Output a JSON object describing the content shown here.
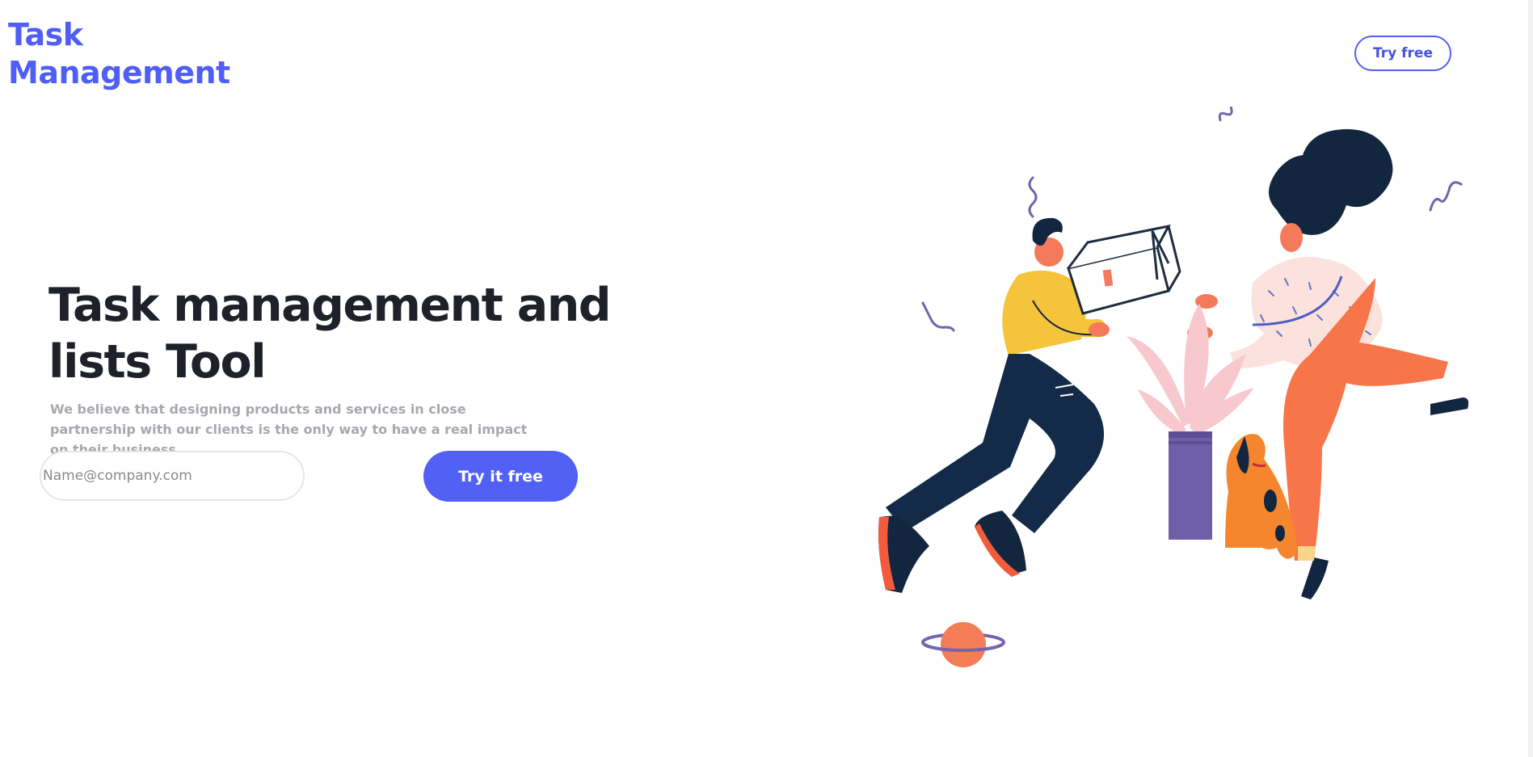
{
  "header": {
    "logo_line1": "Task",
    "logo_line2": "Management",
    "try_free_label": "Try free"
  },
  "hero": {
    "title": "Task management and lists Tool",
    "subtitle": "We believe that designing products and services in close partnership with our clients is the only way to have a real impact on their business.",
    "email_placeholder": "Name@company.com",
    "cta_label": "Try it free"
  },
  "colors": {
    "brand": "#4f5ef6",
    "cta_background": "#5160f5",
    "heading": "#1e2129",
    "subtext": "#a7a7ad"
  },
  "icons": {
    "illustration": "people-exchanging-box-illustration"
  }
}
